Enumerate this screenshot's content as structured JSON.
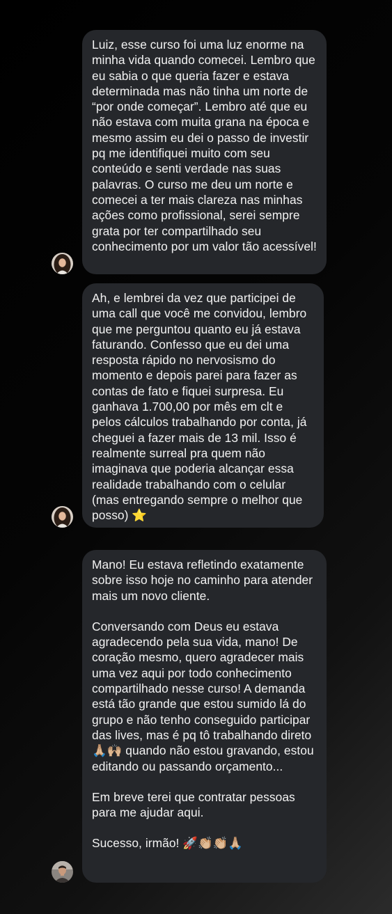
{
  "messages": [
    {
      "sender": "left",
      "paragraphs": [
        "Luiz, esse curso foi uma luz enorme na minha vida quando comecei. Lembro que eu sabia o que queria fazer e estava determinada mas não tinha um norte de “por onde começar”. Lembro até que eu não estava com muita grana na época e mesmo assim eu dei o passo de investir pq me identifiquei muito com seu conteúdo e senti verdade nas suas palavras. O curso me deu um norte e comecei a ter mais clareza nas minhas ações como profissional, serei sempre grata por ter compartilhado seu conhecimento por um valor tão acessível!"
      ]
    },
    {
      "sender": "left",
      "paragraphs": [
        "Ah, e lembrei da vez que participei de uma call que você me convidou, lembro que me perguntou quanto eu já estava faturando. Confesso que eu dei uma resposta rápido no nervosismo do momento e depois parei para fazer as contas de fato e fiquei surpresa. Eu ganhava 1.700,00 por mês em clt e pelos cálculos trabalhando por conta, já cheguei a fazer mais de 13 mil. Isso é realmente surreal pra quem não imaginava que poderia alcançar essa realidade trabalhando com o celular (mas entregando sempre o melhor que posso) ⭐"
      ]
    },
    {
      "sender": "left",
      "paragraphs": [
        "Mano! Eu estava refletindo exatamente sobre isso hoje no caminho para atender mais um novo cliente.",
        "Conversando com Deus eu estava agradecendo pela sua vida, mano! De coração mesmo, quero agradecer mais uma vez aqui por todo conhecimento compartilhado nesse curso! A demanda está tão grande que estou sumido lá do grupo e não tenho conseguido participar das lives, mas é pq tô trabalhando direto 🙏🏼🙌🏼 quando não estou gravando, estou editando ou passando orçamento...",
        "Em breve terei que contratar pessoas para me ajudar aqui.",
        "Sucesso, irmão! 🚀👏🏼👏🏼🙏🏼"
      ]
    }
  ],
  "colors": {
    "bubble": "#25272b",
    "text": "#f2f2f2",
    "background": "#000000"
  },
  "icons": {
    "avatar_1": "profile-photo-woman",
    "avatar_2": "profile-photo-man"
  }
}
